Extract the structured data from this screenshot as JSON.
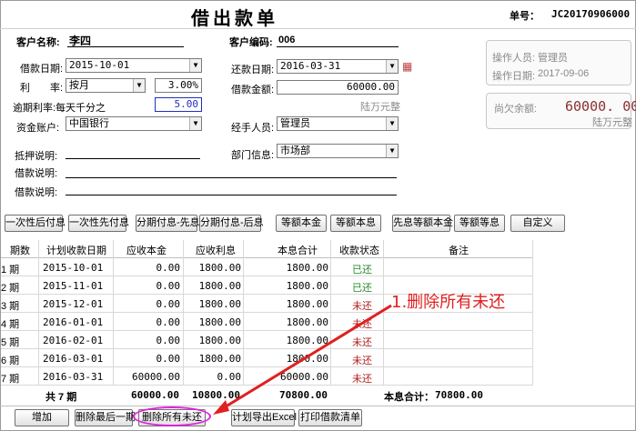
{
  "header": {
    "title": "借出款单",
    "docno_label": "单号：",
    "docno_value": "JC20170906000"
  },
  "form": {
    "customer_name_label": "客户名称:",
    "customer_name_value": "李四",
    "customer_code_label": "客户编码:",
    "customer_code_value": "006",
    "loan_date_label": "借款日期:",
    "loan_date_value": "2015-10-01",
    "repay_date_label": "还款日期:",
    "repay_date_value": "2016-03-31",
    "rate_label": "利　　率:",
    "rate_period_value": "按月",
    "rate_value": "3.00%",
    "loan_amount_label": "借款金额:",
    "loan_amount_value": "60000.00",
    "loan_amount_words": "陆万元整",
    "overdue_label": "逾期利率:每天千分之",
    "overdue_value": "5.00",
    "account_label": "资金账户:",
    "account_value": "中国银行",
    "handler_label": "经手人员:",
    "handler_value": "管理员",
    "mortgage_label": "抵押说明:",
    "dept_label": "部门信息:",
    "dept_value": "市场部",
    "desc1_label": "借款说明:",
    "desc2_label": "借款说明:"
  },
  "side": {
    "operator_label": "操作人员:",
    "operator_value": "管理员",
    "opdate_label": "操作日期:",
    "opdate_value": "2017-09-06",
    "balance_label": "尚欠余额:",
    "balance_value": "60000. 00",
    "balance_words": "陆万元整"
  },
  "toolbar": [
    "一次性后付息",
    "一次性先付息",
    "分期付息-先息",
    "分期付息-后息",
    "等额本金",
    "等额本息",
    "先息等额本金",
    "等额等息",
    "自定义"
  ],
  "grid": {
    "headers": [
      "期数",
      "计划收款日期",
      "应收本金",
      "应收利息",
      "本息合计",
      "收款状态",
      "备注"
    ],
    "rows": [
      {
        "period": "1 期",
        "date": "2015-10-01",
        "principal": "0.00",
        "interest": "1800.00",
        "total": "1800.00",
        "status": "已还",
        "paid": true
      },
      {
        "period": "2 期",
        "date": "2015-11-01",
        "principal": "0.00",
        "interest": "1800.00",
        "total": "1800.00",
        "status": "已还",
        "paid": true
      },
      {
        "period": "3 期",
        "date": "2015-12-01",
        "principal": "0.00",
        "interest": "1800.00",
        "total": "1800.00",
        "status": "未还",
        "paid": false
      },
      {
        "period": "4 期",
        "date": "2016-01-01",
        "principal": "0.00",
        "interest": "1800.00",
        "total": "1800.00",
        "status": "未还",
        "paid": false
      },
      {
        "period": "5 期",
        "date": "2016-02-01",
        "principal": "0.00",
        "interest": "1800.00",
        "total": "1800.00",
        "status": "未还",
        "paid": false
      },
      {
        "period": "6 期",
        "date": "2016-03-01",
        "principal": "0.00",
        "interest": "1800.00",
        "total": "1800.00",
        "status": "未还",
        "paid": false
      },
      {
        "period": "7 期",
        "date": "2016-03-31",
        "principal": "60000.00",
        "interest": "0.00",
        "total": "60000.00",
        "status": "未还",
        "paid": false
      }
    ],
    "summary": {
      "count": "共 7 期",
      "principal": "60000.00",
      "interest": "10800.00",
      "total": "70800.00",
      "grand_label": "本息合计：",
      "grand_value": "70800.00"
    }
  },
  "footer_buttons": [
    "增加",
    "删除最后一期",
    "删除所有未还",
    "计划导出Excel",
    "打印借款清单"
  ],
  "annotation": "1.删除所有未还",
  "colors": {
    "paid": "#2a8a2a",
    "unpaid": "#b02020",
    "annotation": "#e02020",
    "highlight": "#e020e0"
  }
}
